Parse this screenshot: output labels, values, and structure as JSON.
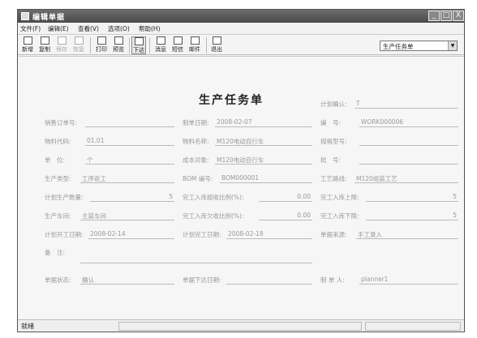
{
  "window": {
    "title": "编辑单据",
    "buttons": [
      "_",
      "□",
      "X"
    ]
  },
  "menu": [
    "文件(F)",
    "编辑(E)",
    "查看(V)",
    "选项(O)",
    "帮助(H)"
  ],
  "toolbar": [
    {
      "label": "新增",
      "icon": "new-doc-icon",
      "disabled": false
    },
    {
      "label": "复制",
      "icon": "copy-icon",
      "disabled": false
    },
    {
      "label": "保存",
      "icon": "save-icon",
      "disabled": true
    },
    {
      "label": "恢复",
      "icon": "undo-icon",
      "disabled": true
    },
    {
      "label": "打印",
      "icon": "print-icon",
      "disabled": false
    },
    {
      "label": "预览",
      "icon": "preview-icon",
      "disabled": false
    },
    {
      "label": "下达",
      "icon": "issue-icon",
      "disabled": false
    },
    {
      "label": "消息",
      "icon": "message-icon",
      "disabled": false
    },
    {
      "label": "短信",
      "icon": "sms-icon",
      "disabled": false
    },
    {
      "label": "邮件",
      "icon": "mail-icon",
      "disabled": false
    },
    {
      "label": "退出",
      "icon": "exit-icon",
      "disabled": false
    }
  ],
  "tooltip": "下达",
  "doc_type_select": "生产任务单",
  "form_title": "生产任务单",
  "fields": {
    "plan_confirm": {
      "label": "计划确认:",
      "value": "T"
    },
    "sales_order": {
      "label": "销售订单号:",
      "value": ""
    },
    "create_date": {
      "label": "制单日期:",
      "value": "2008-02-07"
    },
    "number": {
      "label": "编　号:",
      "value": "WORK000006"
    },
    "material_code": {
      "label": "物料代码:",
      "value": "01.01"
    },
    "material_name": {
      "label": "物料名称:",
      "value": "M120电动自行车"
    },
    "spec_model": {
      "label": "规格型号:",
      "value": ""
    },
    "unit": {
      "label": "单　位:",
      "value": "个"
    },
    "cost_object": {
      "label": "成本对象:",
      "value": "M120电动自行车"
    },
    "batch": {
      "label": "批　号:",
      "value": ""
    },
    "prod_type": {
      "label": "生产类型:",
      "value": "工序返工"
    },
    "bom_no": {
      "label": "BOM 编号:",
      "value": "BOM000001"
    },
    "route": {
      "label": "工艺路线:",
      "value": "M120组装工艺"
    },
    "plan_qty": {
      "label": "计划生产数量:",
      "value": "5"
    },
    "over_ratio": {
      "label": "完工入库超收比例(%):",
      "value": "0.00"
    },
    "upper_limit": {
      "label": "完工入库上限:",
      "value": "5"
    },
    "workshop": {
      "label": "生产车间:",
      "value": "主装车间"
    },
    "under_ratio": {
      "label": "完工入库欠收比例(%):",
      "value": "0.00"
    },
    "lower_limit": {
      "label": "完工入库下限:",
      "value": "5"
    },
    "plan_start": {
      "label": "计划开工日期:",
      "value": "2008-02-14"
    },
    "plan_finish": {
      "label": "计划完工日期:",
      "value": "2008-02-18"
    },
    "source": {
      "label": "单据来源:",
      "value": "手工录入"
    },
    "remark": {
      "label": "备　注:",
      "value": ""
    },
    "status": {
      "label": "单据状态:",
      "value": "确认"
    },
    "issue_date": {
      "label": "单据下达日期:",
      "value": ""
    },
    "creator": {
      "label": "制 单 人:",
      "value": "planner1"
    }
  },
  "status_bar": "就绪"
}
